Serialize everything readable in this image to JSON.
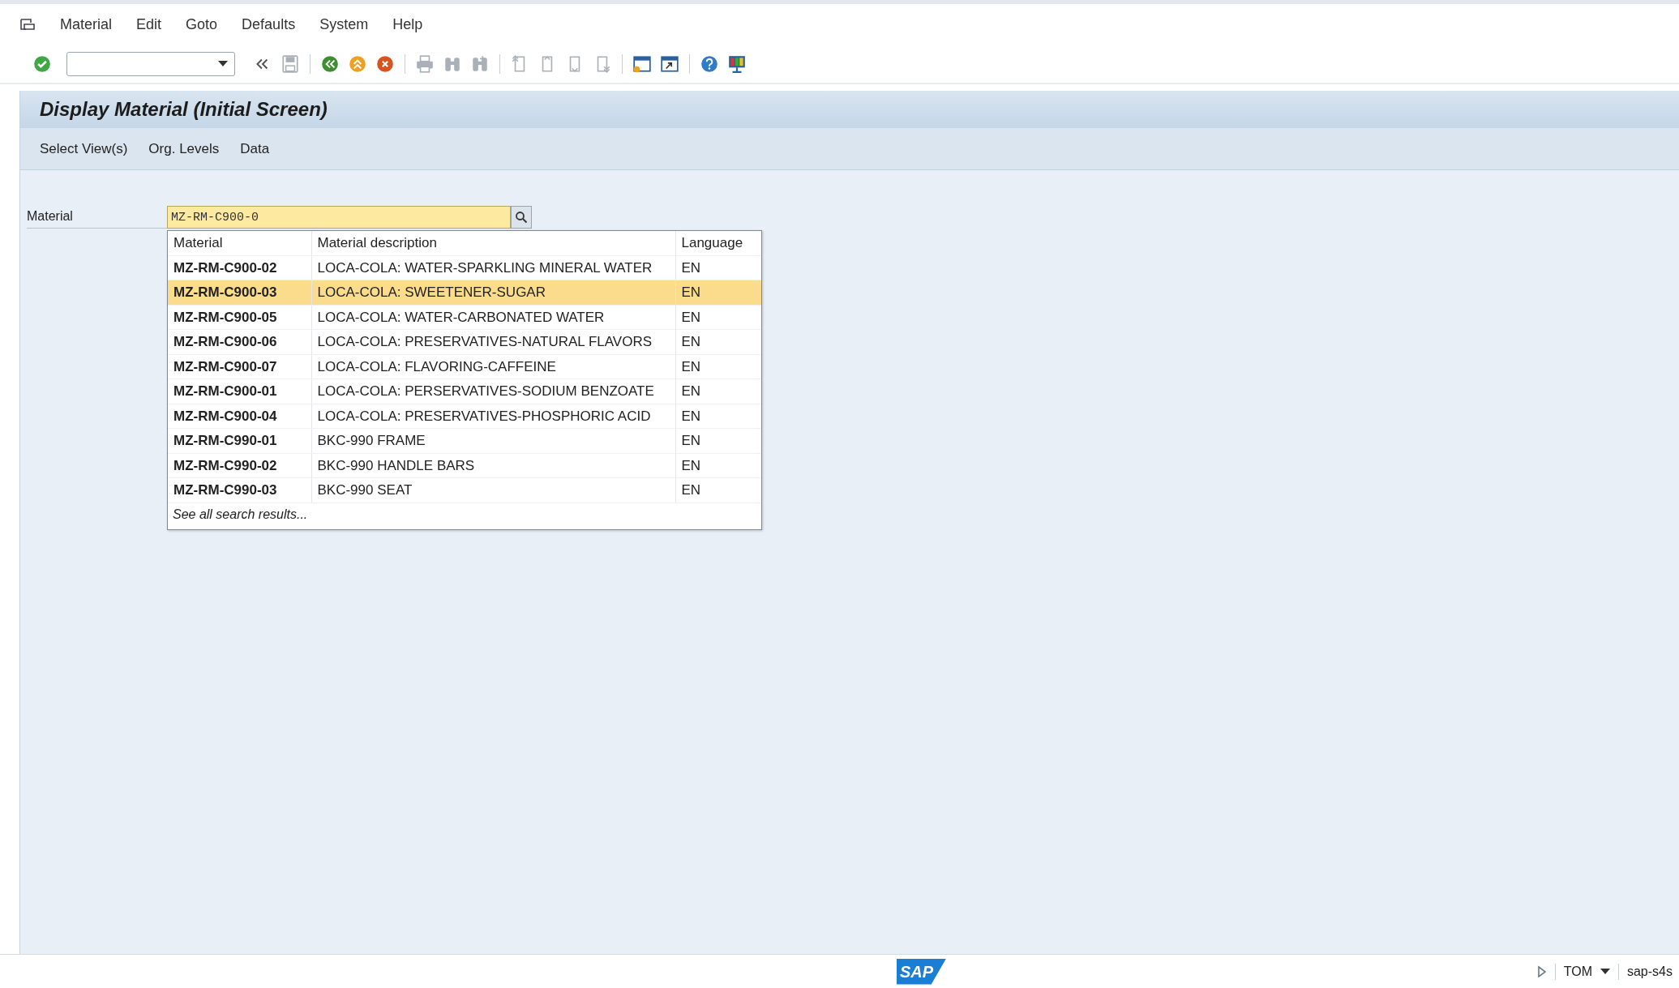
{
  "menu_bar": {
    "items": [
      "Material",
      "Edit",
      "Goto",
      "Defaults",
      "System",
      "Help"
    ]
  },
  "toolbar": {
    "items": [
      {
        "kind": "confirm",
        "disabled": false
      },
      {
        "kind": "command-field"
      },
      {
        "kind": "chevron",
        "disabled": false
      },
      {
        "kind": "save",
        "disabled": true
      },
      {
        "kind": "separator"
      },
      {
        "kind": "back",
        "disabled": false
      },
      {
        "kind": "exit",
        "disabled": false
      },
      {
        "kind": "cancel",
        "disabled": false
      },
      {
        "kind": "separator"
      },
      {
        "kind": "print",
        "disabled": true
      },
      {
        "kind": "find",
        "disabled": true
      },
      {
        "kind": "find-next",
        "disabled": true
      },
      {
        "kind": "separator"
      },
      {
        "kind": "first-page",
        "disabled": true
      },
      {
        "kind": "previous-page",
        "disabled": true
      },
      {
        "kind": "next-page",
        "disabled": true
      },
      {
        "kind": "last-page",
        "disabled": true
      },
      {
        "kind": "separator"
      },
      {
        "kind": "new-window",
        "disabled": false
      },
      {
        "kind": "shortcut",
        "disabled": false
      },
      {
        "kind": "separator"
      },
      {
        "kind": "help",
        "disabled": false
      },
      {
        "kind": "layout",
        "disabled": false
      }
    ]
  },
  "screen": {
    "title": "Display Material (Initial Screen)",
    "actions": [
      "Select View(s)",
      "Org. Levels",
      "Data"
    ]
  },
  "form": {
    "label": "Material",
    "value": "MZ-RM-C900-0"
  },
  "suggestions": {
    "columns": [
      "Material",
      "Material description",
      "Language"
    ],
    "rows": [
      {
        "material": "MZ-RM-C900-02",
        "description": "LOCA-COLA: WATER-SPARKLING MINERAL WATER",
        "language": "EN",
        "selected": false
      },
      {
        "material": "MZ-RM-C900-03",
        "description": "LOCA-COLA: SWEETENER-SUGAR",
        "language": "EN",
        "selected": true
      },
      {
        "material": "MZ-RM-C900-05",
        "description": "LOCA-COLA: WATER-CARBONATED WATER",
        "language": "EN",
        "selected": false
      },
      {
        "material": "MZ-RM-C900-06",
        "description": "LOCA-COLA: PRESERVATIVES-NATURAL FLAVORS",
        "language": "EN",
        "selected": false
      },
      {
        "material": "MZ-RM-C900-07",
        "description": "LOCA-COLA: FLAVORING-CAFFEINE",
        "language": "EN",
        "selected": false
      },
      {
        "material": "MZ-RM-C900-01",
        "description": "LOCA-COLA: PERSERVATIVES-SODIUM BENZOATE",
        "language": "EN",
        "selected": false
      },
      {
        "material": "MZ-RM-C900-04",
        "description": "LOCA-COLA: PRESERVATIVES-PHOSPHORIC ACID",
        "language": "EN",
        "selected": false
      },
      {
        "material": "MZ-RM-C990-01",
        "description": "BKC-990 FRAME",
        "language": "EN",
        "selected": false
      },
      {
        "material": "MZ-RM-C990-02",
        "description": "BKC-990 HANDLE BARS",
        "language": "EN",
        "selected": false
      },
      {
        "material": "MZ-RM-C990-03",
        "description": "BKC-990 SEAT",
        "language": "EN",
        "selected": false
      }
    ],
    "footer": "See all search results..."
  },
  "status_bar": {
    "logo": "SAP",
    "user": "TOM",
    "system": "sap-s4s"
  }
}
